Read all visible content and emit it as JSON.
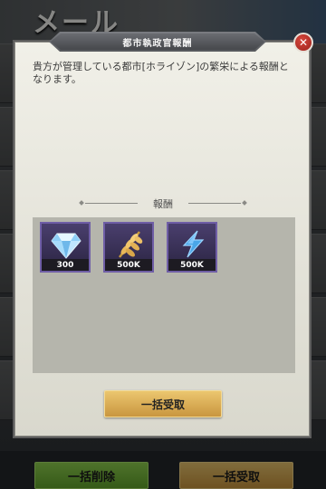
{
  "background": {
    "title": "メール",
    "footer": {
      "delete_all_label": "一括削除",
      "claim_all_label": "一括受取"
    }
  },
  "dialog": {
    "title": "都市執政官報酬",
    "close_glyph": "✕",
    "message": "貴方が管理している都市[ホライゾン]の繁栄による報酬となります。",
    "rewards_label": "報酬",
    "rewards": [
      {
        "icon": "diamond-icon",
        "count": "300"
      },
      {
        "icon": "wheat-icon",
        "count": "500K"
      },
      {
        "icon": "lightning-icon",
        "count": "500K"
      }
    ],
    "claim_button_label": "一括受取"
  },
  "colors": {
    "accent_gold": "#d9ad56",
    "accent_green": "#7bbd3f",
    "close_red": "#c0392b",
    "reward_frame": "#3a3257"
  }
}
